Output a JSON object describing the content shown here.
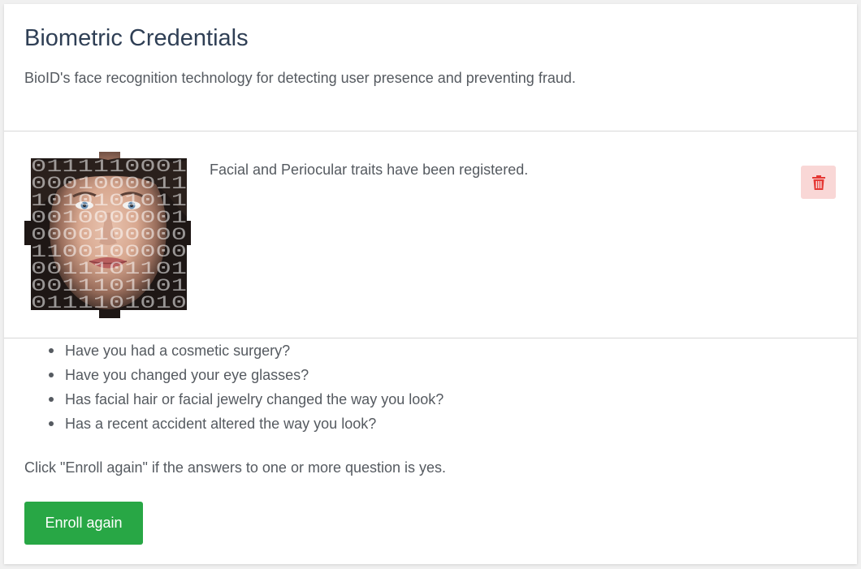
{
  "header": {
    "title": "Biometric Credentials",
    "subtitle": "BioID's face recognition technology for detecting user presence and preventing fraud."
  },
  "enrollment": {
    "image_icon": "binary-face-image",
    "status_text": "Facial and Periocular traits have been registered.",
    "delete_icon": "trash-icon",
    "colors": {
      "delete_bg": "#f9d7d6",
      "delete_icon": "#e53935"
    }
  },
  "questions": [
    "Have you had a cosmetic surgery?",
    "Have you changed your eye glasses?",
    "Has facial hair or facial jewelry changed the way you look?",
    "Has a recent accident altered the way you look?"
  ],
  "hint": "Click \"Enroll again\" if the answers to one or more question is yes.",
  "actions": {
    "enroll_again_label": "Enroll again",
    "enroll_color": "#28a745"
  },
  "face_overlay_digits": [
    "0111110001",
    "0001000011",
    "1010101011",
    "0010000001",
    "0000100000",
    "1100100000",
    "0011101101",
    "0011101101",
    "0111101010"
  ]
}
